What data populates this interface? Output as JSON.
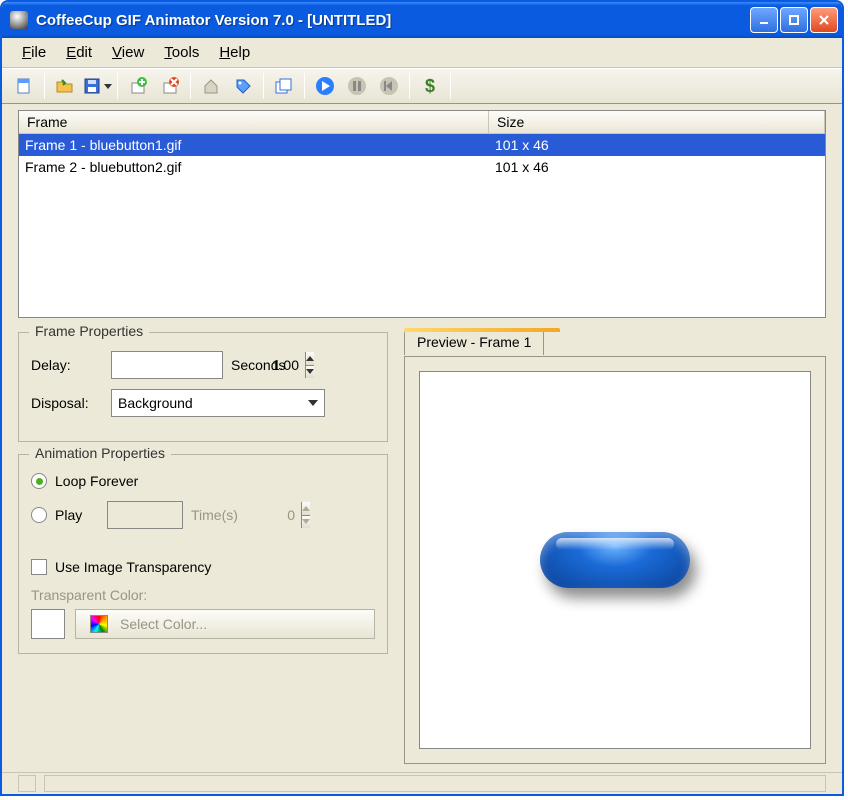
{
  "window": {
    "title": "CoffeeCup GIF Animator Version 7.0 - [UNTITLED]"
  },
  "menu": {
    "file": "File",
    "edit": "Edit",
    "view": "View",
    "tools": "Tools",
    "help": "Help"
  },
  "list": {
    "header_frame": "Frame",
    "header_size": "Size",
    "rows": [
      {
        "frame": "Frame 1 - bluebutton1.gif",
        "size": "101 x 46",
        "selected": true
      },
      {
        "frame": "Frame 2 - bluebutton2.gif",
        "size": "101 x 46",
        "selected": false
      }
    ]
  },
  "frame_props": {
    "group_title": "Frame Properties",
    "delay_label": "Delay:",
    "delay_value": "1.00",
    "delay_unit": "Seconds",
    "disposal_label": "Disposal:",
    "disposal_value": "Background"
  },
  "anim_props": {
    "group_title": "Animation Properties",
    "loop_label": "Loop Forever",
    "play_label": "Play",
    "play_value": "0",
    "play_unit": "Time(s)",
    "transparency_label": "Use Image Transparency",
    "transparent_color_label": "Transparent Color:",
    "select_color_label": "Select Color..."
  },
  "preview": {
    "tab_label": "Preview - Frame 1"
  },
  "colors": {
    "titlebar": "#0a5be0",
    "selection": "#2a5bd7",
    "panel": "#ece9d8"
  }
}
